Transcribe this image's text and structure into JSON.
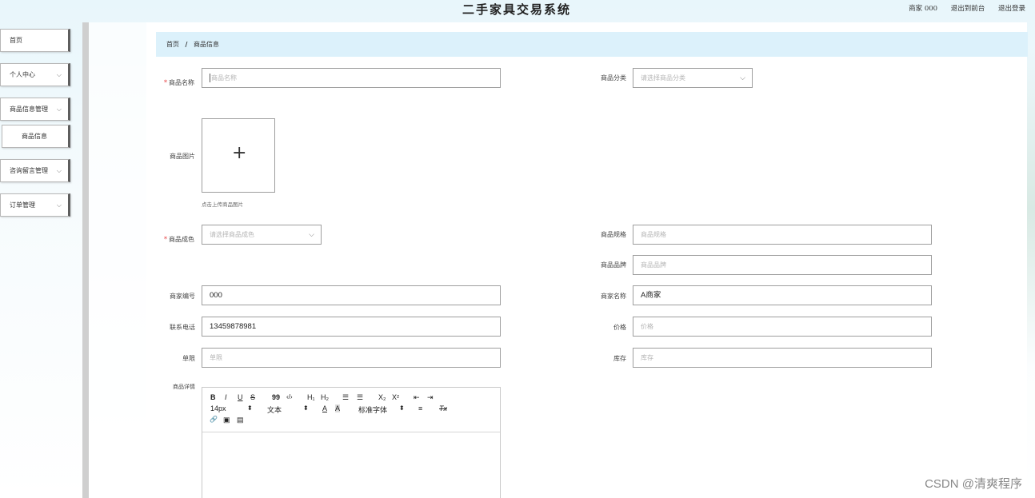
{
  "header": {
    "title": "二手家具交易系统",
    "user": "商家 000",
    "back_to_admin": "退出到前台",
    "logout": "退出登录"
  },
  "sidebar": {
    "items": [
      {
        "label": "首页"
      },
      {
        "label": "个人中心",
        "chevron": "⌵"
      },
      {
        "label": "商品信息管理",
        "chevron": "⌵"
      },
      {
        "label": "商品信息"
      },
      {
        "label": "咨询留言管理",
        "chevron": "⌵"
      },
      {
        "label": "订单管理",
        "chevron": "⌵"
      }
    ]
  },
  "breadcrumb": {
    "home": "首页",
    "sep": "/",
    "current": "商品信息"
  },
  "form": {
    "name": {
      "label": "商品名称",
      "placeholder": "商品名称"
    },
    "category": {
      "label": "商品分类",
      "placeholder": "请选择商品分类"
    },
    "image": {
      "label": "商品图片",
      "hint": "点击上传商品图片",
      "plus": "+"
    },
    "condition": {
      "label": "商品成色",
      "placeholder": "请选择商品成色"
    },
    "spec": {
      "label": "商品规格",
      "placeholder": "商品规格"
    },
    "brand": {
      "label": "商品品牌",
      "placeholder": "商品品牌"
    },
    "merchant_no": {
      "label": "商家编号",
      "value": "000"
    },
    "merchant_name": {
      "label": "商家名称",
      "value": "A商家"
    },
    "phone": {
      "label": "联系电话",
      "value": "13459878981"
    },
    "price": {
      "label": "价格",
      "placeholder": "价格"
    },
    "unit": {
      "label": "单限",
      "placeholder": "单限"
    },
    "stock": {
      "label": "库存",
      "placeholder": "库存"
    },
    "detail": {
      "label": "商品详情"
    }
  },
  "editor_toolbar": {
    "bold": "B",
    "italic": "I",
    "underline": "U",
    "strike": "S",
    "quote": "99",
    "code": "‹/›",
    "h1": "H₁",
    "h2": "H₂",
    "ol": "☰",
    "ul": "☰",
    "sub": "X₂",
    "sup": "X²",
    "indent_left": "⇤",
    "indent_right": "⇥",
    "size": "14px",
    "size_arrow": "⬍",
    "font_type": "文本",
    "font_type_arrow": "⬍",
    "font_color": "A",
    "bg_color": "A",
    "font_family": "标准字体",
    "font_family_arrow": "⬍",
    "align": "≡",
    "clear": "Tx",
    "link": "🔗",
    "image": "▣",
    "video": "▤"
  },
  "watermark": "CSDN @清爽程序",
  "colors": {
    "accent": "#dcf1fb",
    "required": "#e5393b",
    "sidebar_border": "#5e5e5e"
  }
}
